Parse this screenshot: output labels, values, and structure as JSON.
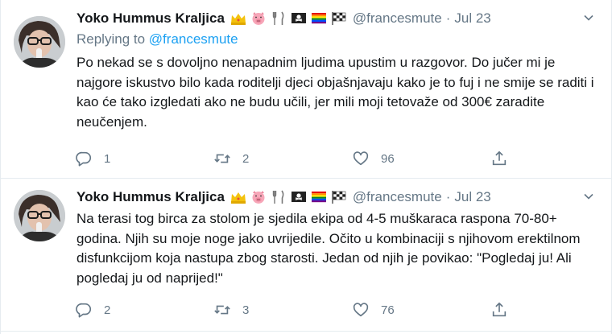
{
  "tweets": [
    {
      "author_name": "Yoko Hummus Kraljica",
      "emojis": [
        "crown-emoji",
        "pig-emoji",
        "fork-knife-emoji",
        "pirate-flag-emoji",
        "rainbow-flag-emoji",
        "checkered-flag-emoji"
      ],
      "handle": "@francesmute",
      "separator": "·",
      "date": "Jul 23",
      "reply_prefix": "Replying to",
      "reply_handle": "@francesmute",
      "text": "Po nekad se s dovoljno nenapadnim ljudima upustim u razgovor. Do jučer mi je najgore iskustvo bilo kada roditelji djeci objašnjavaju kako je to fuj i ne smije se raditi i kao će tako izgledati ako ne budu učili, jer mili moji tetovaže od 300€ zaradite neučenjem.",
      "replies": "1",
      "retweets": "2",
      "likes": "96"
    },
    {
      "author_name": "Yoko Hummus Kraljica",
      "emojis": [
        "crown-emoji",
        "pig-emoji",
        "fork-knife-emoji",
        "pirate-flag-emoji",
        "rainbow-flag-emoji",
        "checkered-flag-emoji"
      ],
      "handle": "@francesmute",
      "separator": "·",
      "date": "Jul 23",
      "text": "Na terasi tog birca za stolom je sjedila ekipa od 4-5 muškaraca raspona 70-80+ godina. Njih su moje noge jako uvrijedile. Očito u kombinaciji s njihovom erektilnom disfunkcijom koja nastupa zbog starosti. Jedan od njih je povikao: \"Pogledaj ju! Ali pogledaj ju od naprijed!\"",
      "replies": "2",
      "retweets": "3",
      "likes": "76"
    }
  ],
  "colors": {
    "text": "#14171a",
    "secondary": "#657786",
    "link": "#1da1f2",
    "border": "#e6ecf0"
  }
}
